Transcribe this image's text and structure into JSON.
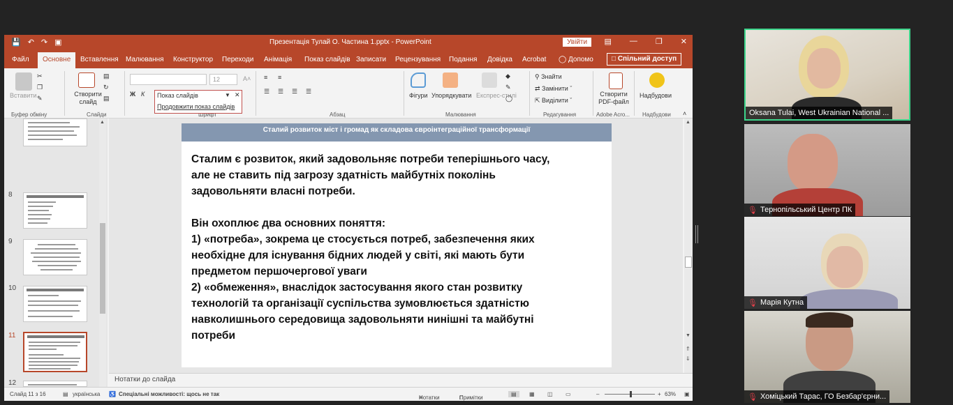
{
  "app": {
    "doc_title": "Презентація Тулай О. Частина 1.pptx  -  PowerPoint",
    "sign_in": "Увійти",
    "share": "Спільний доступ"
  },
  "tabs": [
    "Файл",
    "Основне",
    "Вставлення",
    "Малювання",
    "Конструктор",
    "Переходи",
    "Анімація",
    "Показ слайдів",
    "Записати",
    "Рецензування",
    "Подання",
    "Довідка",
    "Acrobat",
    "Допомо"
  ],
  "ribbon": {
    "paste": "Вставити",
    "clipboard": "Буфер обміну",
    "new_slide": "Створити слайд",
    "slides": "Слайди",
    "font_size": "12",
    "font_group": "Шрифт",
    "paragraph": "Абзац",
    "shapes": "Фігури",
    "arrange": "Упорядкувати",
    "quick_styles": "Експрес-стилі",
    "drawing": "Малювання",
    "find": "Знайти",
    "replace": "Замінити",
    "select": "Виділити",
    "editing": "Редагування",
    "create_pdf": "Створити PDF-файл",
    "adobe": "Adobe Acro...",
    "send": "Надбудови",
    "addins": "Надбудови"
  },
  "dropdown": {
    "title": "Показ слайдів",
    "continue": "Продовжити показ слайдів"
  },
  "thumbnails": [
    {
      "num": "8"
    },
    {
      "num": "9"
    },
    {
      "num": "10"
    },
    {
      "num": "11"
    },
    {
      "num": "12"
    }
  ],
  "slide": {
    "header": "Сталий розвиток міст і громад як складова євроінтеграційної трансформації",
    "lines": [
      "Сталим є розвиток, який задовольняє потреби теперішнього часу,",
      "але не ставить під загрозу здатність майбутніх поколінь",
      "задовольняти власні потреби.",
      "",
      "Він охоплює два основних поняття:",
      "1) «потреба», зокрема це стосується потреб, забезпечення яких",
      "необхідне для існування бідних людей у світі, які мають бути",
      "предметом першочергової уваги",
      "2) «обмеження», внаслідок застосування якого стан розвитку",
      "технологій та організації суспільства зумовлюється здатністю",
      "навколишнього середовища задовольняти нинішні та майбутні",
      "потреби"
    ]
  },
  "notes_placeholder": "Нотатки до слайда",
  "status": {
    "slide": "Слайд 11 з 16",
    "lang": "українська",
    "accessibility": "Спеціальні можливості: щось не так",
    "notes": "Нотатки",
    "comments": "Примітки",
    "zoom": "63%"
  },
  "participants": [
    {
      "name": "Oksana Tulai, West Ukrainian National ..."
    },
    {
      "name": "Тернопільський Центр ПК"
    },
    {
      "name": "Марія Кутна"
    },
    {
      "name": "Хоміцький Тарас, ГО Безбар'єрни..."
    }
  ]
}
